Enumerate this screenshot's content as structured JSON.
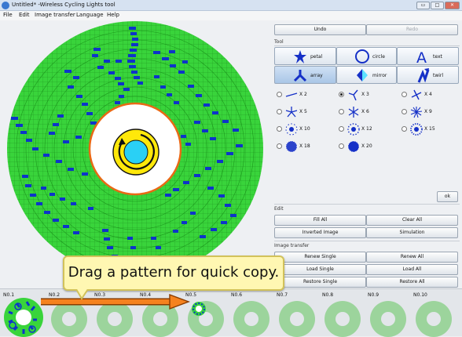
{
  "window": {
    "title": "Untitled* -Wireless Cycling Lights tool",
    "minimize": "▭",
    "maximize": "□",
    "close": "✕"
  },
  "menu": [
    "File",
    "Edit",
    "Image transfer",
    "Language",
    "Help"
  ],
  "toolbar": {
    "undo": "Undo",
    "redo": "Redo"
  },
  "tool_section": "Tool",
  "tools": [
    {
      "label": "petal",
      "icon": "petal-icon"
    },
    {
      "label": "circle",
      "icon": "circle-icon"
    },
    {
      "label": "text",
      "icon": "text-icon"
    },
    {
      "label": "array",
      "icon": "array-icon",
      "selected": true
    },
    {
      "label": "mirror",
      "icon": "mirror-icon"
    },
    {
      "label": "twirl",
      "icon": "twirl-icon"
    }
  ],
  "array_options": [
    "X 2",
    "X 3",
    "X 4",
    "X 5",
    "X 6",
    "X 9",
    "X 10",
    "X 12",
    "X 15",
    "X 18",
    "X 20"
  ],
  "array_selected": "X 3",
  "ok": "ok",
  "edit": {
    "title": "Edit",
    "fill_all": "Fill All",
    "clear_all": "Clear All",
    "inverted": "Inverted Image",
    "simulation": "Simulation"
  },
  "transfer": {
    "title": "Image transfer",
    "renew_single": "Renew Single",
    "renew_all": "Renew All",
    "load_single": "Load Single",
    "load_all": "Load All",
    "restore_single": "Restore Single",
    "restore_all": "Restore All"
  },
  "slots": [
    "N0.1",
    "N0.2",
    "N0.3",
    "N0.4",
    "N0.5",
    "N0.6",
    "N0.7",
    "N0.8",
    "N0.9",
    "N0.10"
  ],
  "callout": "Drag a pattern for quick copy.",
  "colors": {
    "wheel": "#39d43b",
    "led": "#0d35c9",
    "hub": "#ffe80a",
    "hub_center": "#2ad0f5"
  }
}
